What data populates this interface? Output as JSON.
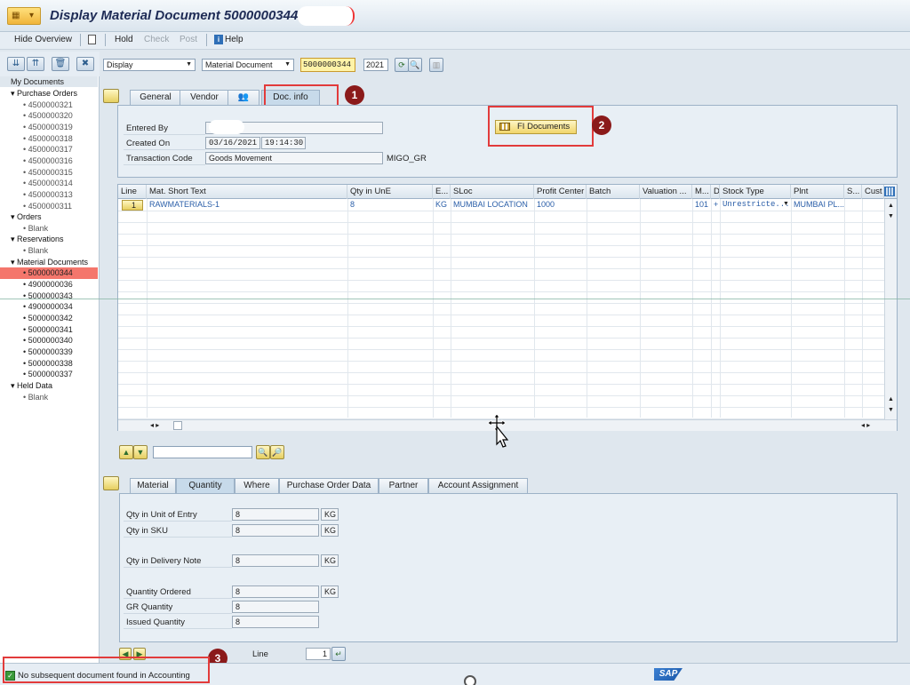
{
  "window": {
    "title": "Display Material Document 5000000344"
  },
  "appbar": {
    "hide_overview": "Hide Overview",
    "hold": "Hold",
    "check": "Check",
    "post": "Post",
    "help": "Help"
  },
  "tree": {
    "header": "My Documents",
    "purchase_orders": {
      "label": "Purchase Orders",
      "items": [
        "4500000321",
        "4500000320",
        "4500000319",
        "4500000318",
        "4500000317",
        "4500000316",
        "4500000315",
        "4500000314",
        "4500000313",
        "4500000311"
      ]
    },
    "orders": {
      "label": "Orders",
      "items": [
        "Blank"
      ]
    },
    "reservations": {
      "label": "Reservations",
      "items": [
        "Blank"
      ]
    },
    "material_documents": {
      "label": "Material Documents",
      "items": [
        "5000000344",
        "4900000036",
        "5000000343",
        "4900000034",
        "5000000342",
        "5000000341",
        "5000000340",
        "5000000339",
        "5000000338",
        "5000000337"
      ],
      "selected": "5000000344"
    },
    "held_data": {
      "label": "Held Data",
      "items": [
        "Blank"
      ]
    }
  },
  "top": {
    "action": "Display",
    "ref_doc": "Material Document",
    "doc_number": "5000000344",
    "year": "2021"
  },
  "header_tabs": [
    "General",
    "Vendor",
    "",
    "Doc. info"
  ],
  "header_tab_active": "Doc. info",
  "docinfo": {
    "entered_by_label": "Entered By",
    "entered_by": "",
    "created_on_label": "Created On",
    "created_date": "03/16/2021",
    "created_time": "19:14:30",
    "tcode_label": "Transaction Code",
    "tcode_text": "Goods Movement",
    "tcode": "MIGO_GR",
    "fi_button": "FI Documents"
  },
  "grid": {
    "columns": [
      "Line",
      "Mat. Short Text",
      "Qty in UnE",
      "E...",
      "SLoc",
      "Profit Center",
      "Batch",
      "Valuation ...",
      "M...",
      "D",
      "Stock Type",
      "Plnt",
      "S...",
      "Cust"
    ],
    "rows": [
      {
        "line": "1",
        "mat": "RAWMATERIALS-1",
        "qty": "8",
        "unit": "KG",
        "sloc": "MUMBAI LOCATION",
        "profit": "1000",
        "batch": "",
        "val": "",
        "mvt": "101",
        "d": "+",
        "stock": "Unrestricte...",
        "plant": "MUMBAI PL..."
      }
    ]
  },
  "item_tabs": [
    "Material",
    "Quantity",
    "Where",
    "Purchase Order Data",
    "Partner",
    "Account Assignment"
  ],
  "item_tab_active": "Quantity",
  "quantity": {
    "qty_entry_label": "Qty in Unit of Entry",
    "qty_entry": "8",
    "qty_entry_unit": "KG",
    "qty_sku_label": "Qty in SKU",
    "qty_sku": "8",
    "qty_sku_unit": "KG",
    "qty_dn_label": "Qty in Delivery Note",
    "qty_dn": "8",
    "qty_dn_unit": "KG",
    "qty_ordered_label": "Quantity Ordered",
    "qty_ordered": "8",
    "qty_ordered_unit": "KG",
    "gr_qty_label": "GR Quantity",
    "gr_qty": "8",
    "issued_qty_label": "Issued Quantity",
    "issued_qty": "8"
  },
  "line_nav": {
    "label": "Line",
    "value": "1"
  },
  "status": {
    "message": "No subsequent document found in Accounting"
  },
  "annotations": {
    "b1": "1",
    "b2": "2",
    "b3": "3"
  },
  "colors": {
    "highlight": "#e23b3b",
    "badge": "#8b1a1a",
    "selected_row": "#f4766c",
    "doc_field": "#fff3a8"
  },
  "sap_logo": "SAP"
}
